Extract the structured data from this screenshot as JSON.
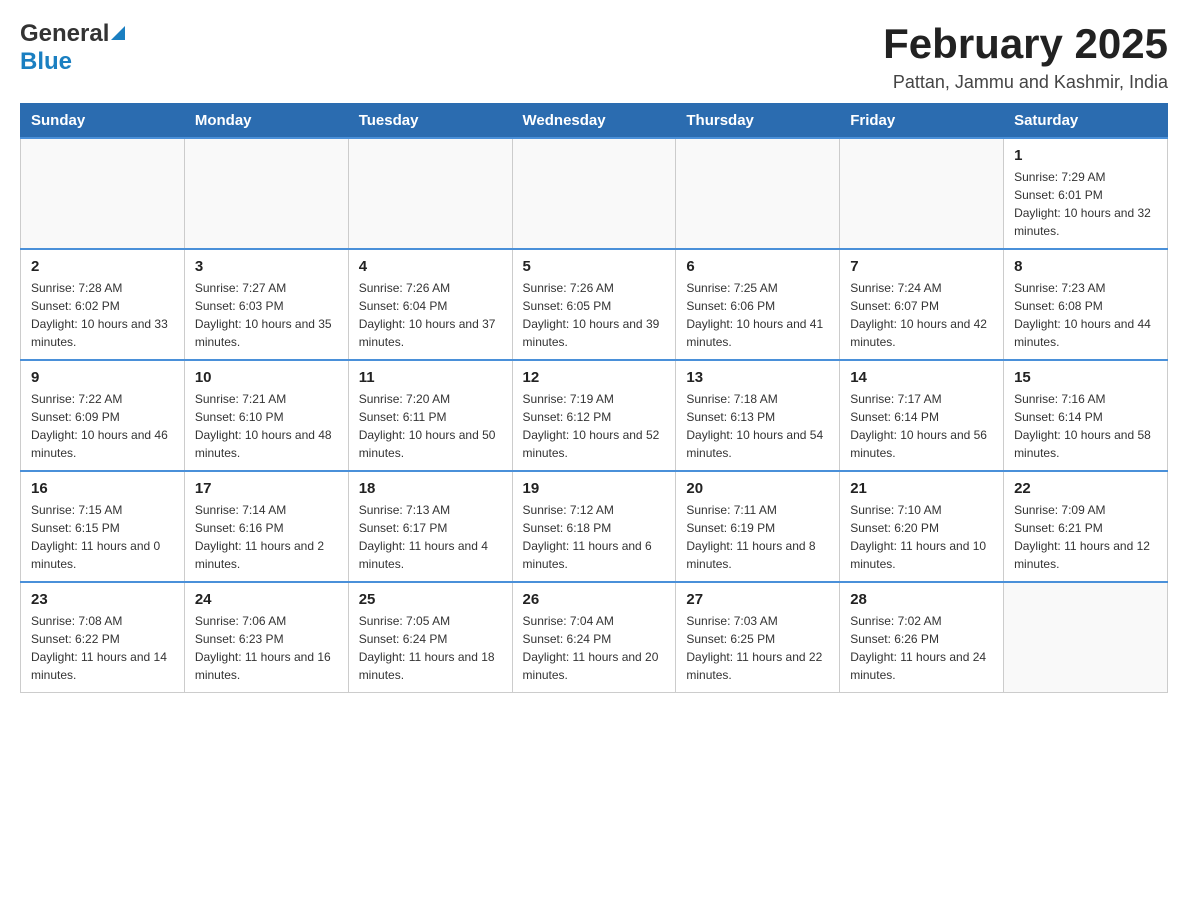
{
  "header": {
    "logo_general": "General",
    "logo_blue": "Blue",
    "month_title": "February 2025",
    "location": "Pattan, Jammu and Kashmir, India"
  },
  "days_of_week": [
    "Sunday",
    "Monday",
    "Tuesday",
    "Wednesday",
    "Thursday",
    "Friday",
    "Saturday"
  ],
  "weeks": [
    [
      {
        "day": "",
        "sunrise": "",
        "sunset": "",
        "daylight": ""
      },
      {
        "day": "",
        "sunrise": "",
        "sunset": "",
        "daylight": ""
      },
      {
        "day": "",
        "sunrise": "",
        "sunset": "",
        "daylight": ""
      },
      {
        "day": "",
        "sunrise": "",
        "sunset": "",
        "daylight": ""
      },
      {
        "day": "",
        "sunrise": "",
        "sunset": "",
        "daylight": ""
      },
      {
        "day": "",
        "sunrise": "",
        "sunset": "",
        "daylight": ""
      },
      {
        "day": "1",
        "sunrise": "Sunrise: 7:29 AM",
        "sunset": "Sunset: 6:01 PM",
        "daylight": "Daylight: 10 hours and 32 minutes."
      }
    ],
    [
      {
        "day": "2",
        "sunrise": "Sunrise: 7:28 AM",
        "sunset": "Sunset: 6:02 PM",
        "daylight": "Daylight: 10 hours and 33 minutes."
      },
      {
        "day": "3",
        "sunrise": "Sunrise: 7:27 AM",
        "sunset": "Sunset: 6:03 PM",
        "daylight": "Daylight: 10 hours and 35 minutes."
      },
      {
        "day": "4",
        "sunrise": "Sunrise: 7:26 AM",
        "sunset": "Sunset: 6:04 PM",
        "daylight": "Daylight: 10 hours and 37 minutes."
      },
      {
        "day": "5",
        "sunrise": "Sunrise: 7:26 AM",
        "sunset": "Sunset: 6:05 PM",
        "daylight": "Daylight: 10 hours and 39 minutes."
      },
      {
        "day": "6",
        "sunrise": "Sunrise: 7:25 AM",
        "sunset": "Sunset: 6:06 PM",
        "daylight": "Daylight: 10 hours and 41 minutes."
      },
      {
        "day": "7",
        "sunrise": "Sunrise: 7:24 AM",
        "sunset": "Sunset: 6:07 PM",
        "daylight": "Daylight: 10 hours and 42 minutes."
      },
      {
        "day": "8",
        "sunrise": "Sunrise: 7:23 AM",
        "sunset": "Sunset: 6:08 PM",
        "daylight": "Daylight: 10 hours and 44 minutes."
      }
    ],
    [
      {
        "day": "9",
        "sunrise": "Sunrise: 7:22 AM",
        "sunset": "Sunset: 6:09 PM",
        "daylight": "Daylight: 10 hours and 46 minutes."
      },
      {
        "day": "10",
        "sunrise": "Sunrise: 7:21 AM",
        "sunset": "Sunset: 6:10 PM",
        "daylight": "Daylight: 10 hours and 48 minutes."
      },
      {
        "day": "11",
        "sunrise": "Sunrise: 7:20 AM",
        "sunset": "Sunset: 6:11 PM",
        "daylight": "Daylight: 10 hours and 50 minutes."
      },
      {
        "day": "12",
        "sunrise": "Sunrise: 7:19 AM",
        "sunset": "Sunset: 6:12 PM",
        "daylight": "Daylight: 10 hours and 52 minutes."
      },
      {
        "day": "13",
        "sunrise": "Sunrise: 7:18 AM",
        "sunset": "Sunset: 6:13 PM",
        "daylight": "Daylight: 10 hours and 54 minutes."
      },
      {
        "day": "14",
        "sunrise": "Sunrise: 7:17 AM",
        "sunset": "Sunset: 6:14 PM",
        "daylight": "Daylight: 10 hours and 56 minutes."
      },
      {
        "day": "15",
        "sunrise": "Sunrise: 7:16 AM",
        "sunset": "Sunset: 6:14 PM",
        "daylight": "Daylight: 10 hours and 58 minutes."
      }
    ],
    [
      {
        "day": "16",
        "sunrise": "Sunrise: 7:15 AM",
        "sunset": "Sunset: 6:15 PM",
        "daylight": "Daylight: 11 hours and 0 minutes."
      },
      {
        "day": "17",
        "sunrise": "Sunrise: 7:14 AM",
        "sunset": "Sunset: 6:16 PM",
        "daylight": "Daylight: 11 hours and 2 minutes."
      },
      {
        "day": "18",
        "sunrise": "Sunrise: 7:13 AM",
        "sunset": "Sunset: 6:17 PM",
        "daylight": "Daylight: 11 hours and 4 minutes."
      },
      {
        "day": "19",
        "sunrise": "Sunrise: 7:12 AM",
        "sunset": "Sunset: 6:18 PM",
        "daylight": "Daylight: 11 hours and 6 minutes."
      },
      {
        "day": "20",
        "sunrise": "Sunrise: 7:11 AM",
        "sunset": "Sunset: 6:19 PM",
        "daylight": "Daylight: 11 hours and 8 minutes."
      },
      {
        "day": "21",
        "sunrise": "Sunrise: 7:10 AM",
        "sunset": "Sunset: 6:20 PM",
        "daylight": "Daylight: 11 hours and 10 minutes."
      },
      {
        "day": "22",
        "sunrise": "Sunrise: 7:09 AM",
        "sunset": "Sunset: 6:21 PM",
        "daylight": "Daylight: 11 hours and 12 minutes."
      }
    ],
    [
      {
        "day": "23",
        "sunrise": "Sunrise: 7:08 AM",
        "sunset": "Sunset: 6:22 PM",
        "daylight": "Daylight: 11 hours and 14 minutes."
      },
      {
        "day": "24",
        "sunrise": "Sunrise: 7:06 AM",
        "sunset": "Sunset: 6:23 PM",
        "daylight": "Daylight: 11 hours and 16 minutes."
      },
      {
        "day": "25",
        "sunrise": "Sunrise: 7:05 AM",
        "sunset": "Sunset: 6:24 PM",
        "daylight": "Daylight: 11 hours and 18 minutes."
      },
      {
        "day": "26",
        "sunrise": "Sunrise: 7:04 AM",
        "sunset": "Sunset: 6:24 PM",
        "daylight": "Daylight: 11 hours and 20 minutes."
      },
      {
        "day": "27",
        "sunrise": "Sunrise: 7:03 AM",
        "sunset": "Sunset: 6:25 PM",
        "daylight": "Daylight: 11 hours and 22 minutes."
      },
      {
        "day": "28",
        "sunrise": "Sunrise: 7:02 AM",
        "sunset": "Sunset: 6:26 PM",
        "daylight": "Daylight: 11 hours and 24 minutes."
      },
      {
        "day": "",
        "sunrise": "",
        "sunset": "",
        "daylight": ""
      }
    ]
  ]
}
